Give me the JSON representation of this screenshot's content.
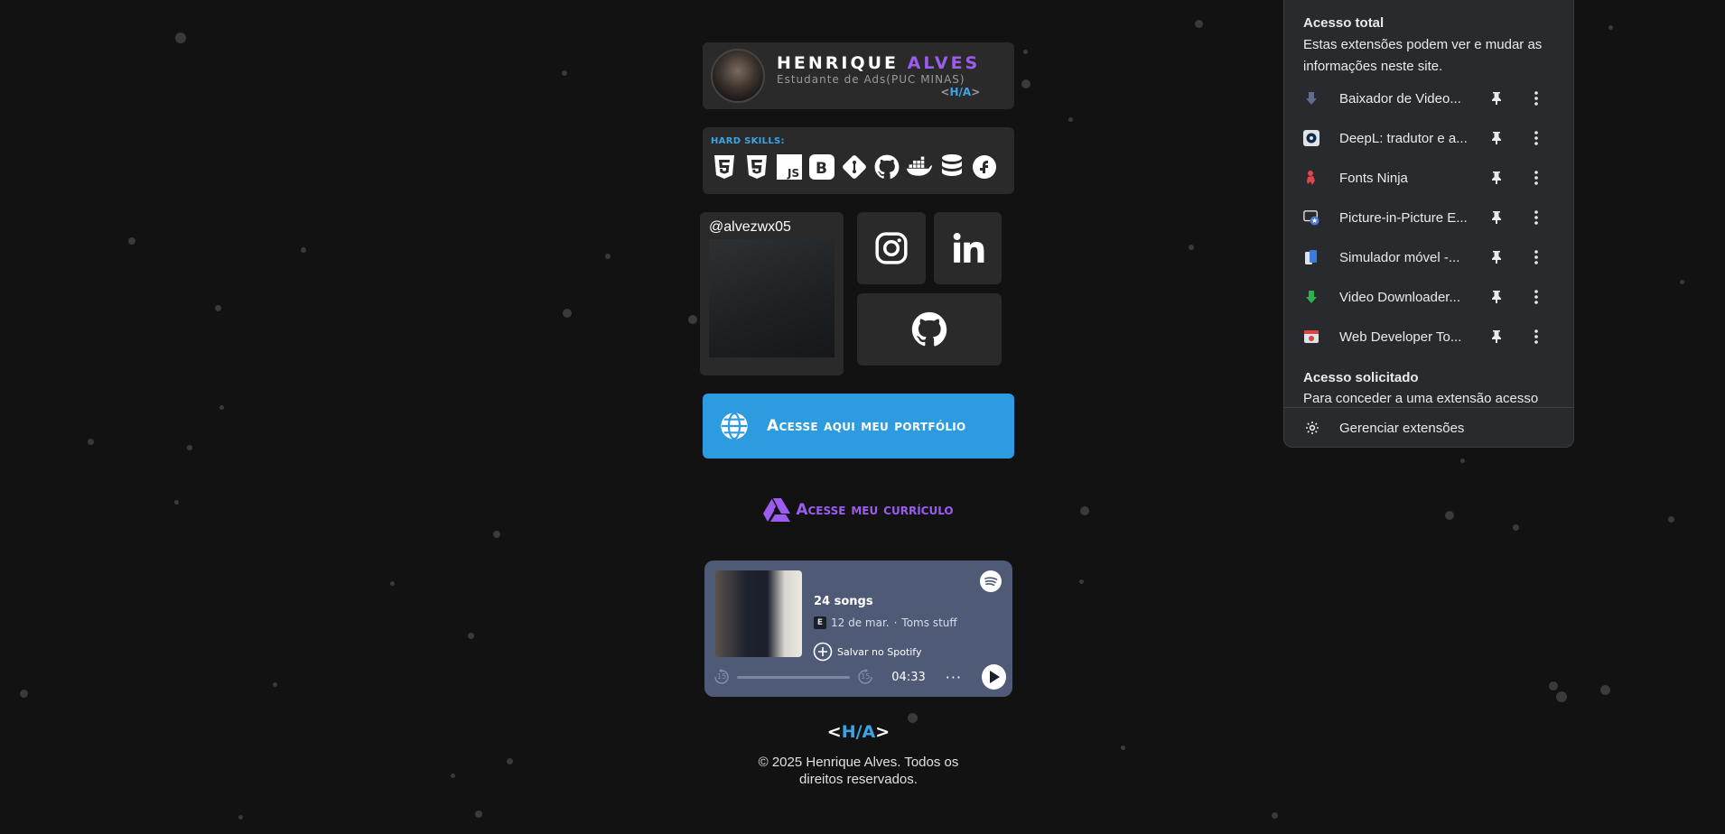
{
  "profile": {
    "first_name": "HENRIQUE",
    "last_name": "ALVES",
    "subtitle": "Estudante de Ads(PUC MINAS)",
    "logo_open": "<",
    "logo_text": "H/A",
    "logo_close": ">"
  },
  "skills": {
    "title": "HARD SKILLS:",
    "items": [
      "html5-icon",
      "css3-icon",
      "javascript-icon",
      "bootstrap-icon",
      "git-icon",
      "github-icon",
      "docker-icon",
      "database-icon",
      "fedora-icon"
    ]
  },
  "instagram_card": {
    "handle": "@alvezwx05"
  },
  "social": {
    "instagram": "instagram-icon",
    "linkedin": "linkedin-icon",
    "github": "github-icon"
  },
  "portfolio": {
    "label": "Acesse aqui meu portfólio"
  },
  "curriculum": {
    "label": "Acesse meu currículo"
  },
  "spotify": {
    "title": "24 songs",
    "explicit": "E",
    "date": "12 de mar.",
    "separator": "·",
    "artist": "Toms stuff",
    "save_label": "Salvar no Spotify",
    "skip_back": "15",
    "skip_fwd": "15",
    "time": "04:33",
    "more": "···",
    "progress": 0
  },
  "footer": {
    "logo_open": "<",
    "logo_text": "H/A",
    "logo_close": ">",
    "copyright": "© 2025 Henrique Alves. Todos os direitos reservados."
  },
  "extensions": {
    "full_access_title": "Acesso total",
    "full_access_desc": "Estas extensões podem ver e mudar as informações neste site.",
    "items": [
      {
        "name": "Baixador de Video...",
        "icon": "download-arrow-icon",
        "color": "#5f6e8c"
      },
      {
        "name": "DeepL: tradutor e a...",
        "icon": "deepl-icon",
        "color": "#0f2b46"
      },
      {
        "name": "Fonts Ninja",
        "icon": "fonts-ninja-icon",
        "color": "#e0474c"
      },
      {
        "name": "Picture-in-Picture E...",
        "icon": "pip-icon",
        "color": "#4a7bd0"
      },
      {
        "name": "Simulador móvel -...",
        "icon": "mobile-simulator-icon",
        "color": "#3b7be0"
      },
      {
        "name": "Video Downloader...",
        "icon": "video-downloader-icon",
        "color": "#2db24a"
      },
      {
        "name": "Web Developer To...",
        "icon": "web-developer-icon",
        "color": "#d9463d"
      }
    ],
    "requested_title": "Acesso solicitado",
    "requested_desc": "Para conceder a uma extensão acesso",
    "manage_label": "Gerenciar extensões"
  },
  "colors": {
    "background": "#121212",
    "card": "#2a2a2a",
    "accent_blue": "#2d9be0",
    "accent_purple": "#9c5cf0",
    "spotify_card": "#4e5a76"
  }
}
